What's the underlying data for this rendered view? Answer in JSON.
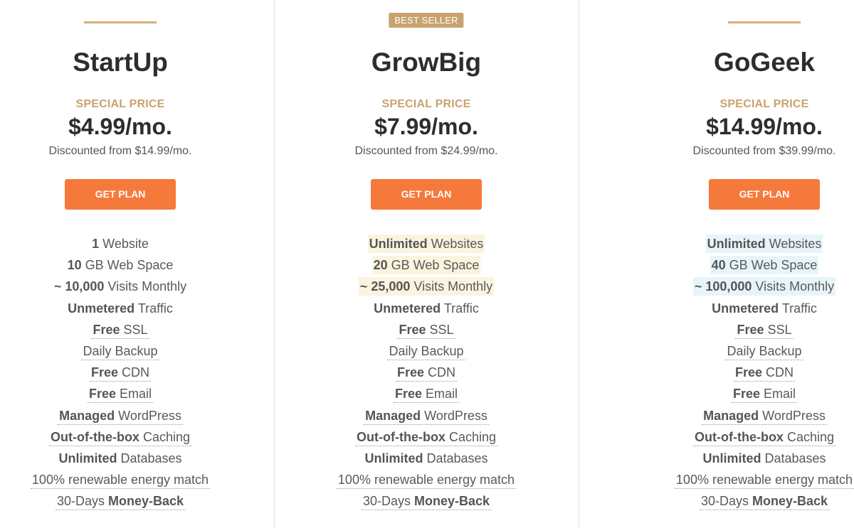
{
  "accent_color": "#d6b07c",
  "button_color": "#f6793c",
  "badge_color": "#c8a36e",
  "plans": [
    {
      "name": "StartUp",
      "badge": null,
      "special_label": "SPECIAL PRICE",
      "price": "$4.99/mo.",
      "discounted": "Discounted from $14.99/mo.",
      "button": "GET PLAN",
      "features": [
        {
          "bold": "1",
          "text": " Website",
          "bold_after": "",
          "highlight": false,
          "dotted": false
        },
        {
          "bold": "10",
          "text": " GB Web Space",
          "bold_after": "",
          "highlight": false,
          "dotted": false
        },
        {
          "bold": "~ 10,000",
          "text": " Visits Monthly",
          "bold_after": "",
          "highlight": false,
          "dotted": false
        },
        {
          "bold": "Unmetered",
          "text": " Traffic",
          "bold_after": "",
          "highlight": false,
          "dotted": false
        },
        {
          "bold": "Free",
          "text": " SSL",
          "bold_after": "",
          "highlight": false,
          "dotted": true
        },
        {
          "bold": "",
          "text": "Daily Backup",
          "bold_after": "",
          "highlight": false,
          "dotted": true
        },
        {
          "bold": "Free",
          "text": " CDN",
          "bold_after": "",
          "highlight": false,
          "dotted": true
        },
        {
          "bold": "Free",
          "text": " Email",
          "bold_after": "",
          "highlight": false,
          "dotted": true
        },
        {
          "bold": "Managed",
          "text": " WordPress",
          "bold_after": "",
          "highlight": false,
          "dotted": true
        },
        {
          "bold": "Out-of-the-box",
          "text": " Caching",
          "bold_after": "",
          "highlight": false,
          "dotted": true
        },
        {
          "bold": "Unlimited",
          "text": " Databases",
          "bold_after": "",
          "highlight": false,
          "dotted": false
        },
        {
          "bold": "",
          "text": "100% renewable energy match",
          "bold_after": "",
          "highlight": false,
          "dotted": true
        },
        {
          "bold": "",
          "text": "30-Days ",
          "bold_after": "Money-Back",
          "highlight": false,
          "dotted": true
        }
      ]
    },
    {
      "name": "GrowBig",
      "badge": "BEST SELLER",
      "special_label": "SPECIAL PRICE",
      "price": "$7.99/mo.",
      "discounted": "Discounted from $24.99/mo.",
      "button": "GET PLAN",
      "features": [
        {
          "bold": "Unlimited",
          "text": " Websites",
          "bold_after": "",
          "highlight": "beige",
          "dotted": false
        },
        {
          "bold": "20",
          "text": " GB Web Space",
          "bold_after": "",
          "highlight": "beige",
          "dotted": false
        },
        {
          "bold": "~ 25,000",
          "text": " Visits Monthly",
          "bold_after": "",
          "highlight": "beige",
          "dotted": false
        },
        {
          "bold": "Unmetered",
          "text": " Traffic",
          "bold_after": "",
          "highlight": false,
          "dotted": false
        },
        {
          "bold": "Free",
          "text": " SSL",
          "bold_after": "",
          "highlight": false,
          "dotted": true
        },
        {
          "bold": "",
          "text": "Daily Backup",
          "bold_after": "",
          "highlight": false,
          "dotted": true
        },
        {
          "bold": "Free",
          "text": " CDN",
          "bold_after": "",
          "highlight": false,
          "dotted": true
        },
        {
          "bold": "Free",
          "text": " Email",
          "bold_after": "",
          "highlight": false,
          "dotted": true
        },
        {
          "bold": "Managed",
          "text": " WordPress",
          "bold_after": "",
          "highlight": false,
          "dotted": true
        },
        {
          "bold": "Out-of-the-box",
          "text": " Caching",
          "bold_after": "",
          "highlight": false,
          "dotted": true
        },
        {
          "bold": "Unlimited",
          "text": " Databases",
          "bold_after": "",
          "highlight": false,
          "dotted": false
        },
        {
          "bold": "",
          "text": "100% renewable energy match",
          "bold_after": "",
          "highlight": false,
          "dotted": true
        },
        {
          "bold": "",
          "text": "30-Days ",
          "bold_after": "Money-Back",
          "highlight": false,
          "dotted": true
        }
      ]
    },
    {
      "name": "GoGeek",
      "badge": null,
      "special_label": "SPECIAL PRICE",
      "price": "$14.99/mo.",
      "discounted": "Discounted from $39.99/mo.",
      "button": "GET PLAN",
      "features": [
        {
          "bold": "Unlimited",
          "text": " Websites",
          "bold_after": "",
          "highlight": "blue",
          "dotted": false
        },
        {
          "bold": "40",
          "text": " GB Web Space",
          "bold_after": "",
          "highlight": "blue",
          "dotted": false
        },
        {
          "bold": "~ 100,000",
          "text": " Visits Monthly",
          "bold_after": "",
          "highlight": "blue",
          "dotted": false
        },
        {
          "bold": "Unmetered",
          "text": " Traffic",
          "bold_after": "",
          "highlight": false,
          "dotted": false
        },
        {
          "bold": "Free",
          "text": " SSL",
          "bold_after": "",
          "highlight": false,
          "dotted": true
        },
        {
          "bold": "",
          "text": "Daily Backup",
          "bold_after": "",
          "highlight": false,
          "dotted": true
        },
        {
          "bold": "Free",
          "text": " CDN",
          "bold_after": "",
          "highlight": false,
          "dotted": true
        },
        {
          "bold": "Free",
          "text": " Email",
          "bold_after": "",
          "highlight": false,
          "dotted": true
        },
        {
          "bold": "Managed",
          "text": " WordPress",
          "bold_after": "",
          "highlight": false,
          "dotted": true
        },
        {
          "bold": "Out-of-the-box",
          "text": " Caching",
          "bold_after": "",
          "highlight": false,
          "dotted": true
        },
        {
          "bold": "Unlimited",
          "text": " Databases",
          "bold_after": "",
          "highlight": false,
          "dotted": false
        },
        {
          "bold": "",
          "text": "100% renewable energy match",
          "bold_after": "",
          "highlight": false,
          "dotted": true
        },
        {
          "bold": "",
          "text": "30-Days ",
          "bold_after": "Money-Back",
          "highlight": false,
          "dotted": true
        }
      ]
    }
  ]
}
